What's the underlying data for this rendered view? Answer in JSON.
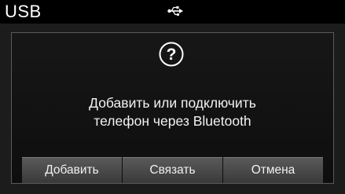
{
  "header": {
    "title": "USB",
    "status_icon": "usb-icon"
  },
  "dialog": {
    "icon": "question-icon",
    "message_line1": "Добавить или подключить",
    "message_line2": "телефон через Bluetooth",
    "buttons": [
      {
        "label": "Добавить"
      },
      {
        "label": "Связать"
      },
      {
        "label": "Отмена"
      }
    ]
  }
}
